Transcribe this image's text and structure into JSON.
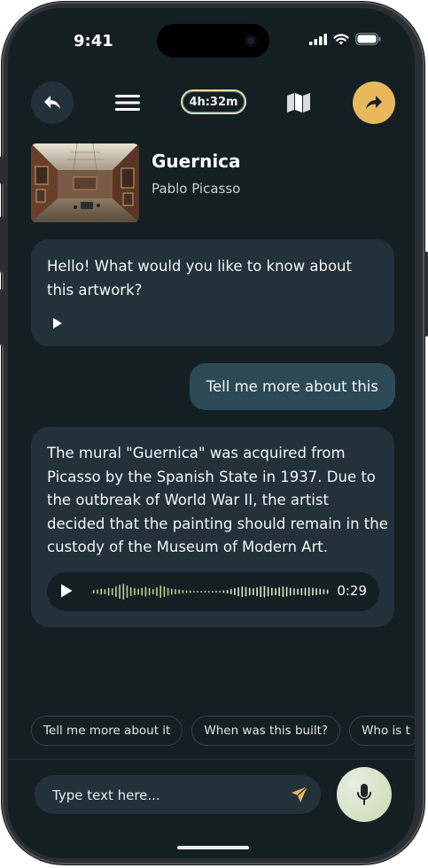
{
  "status_bar": {
    "time": "9:41"
  },
  "toolbar": {
    "timer": "4h:32m"
  },
  "artwork": {
    "title": "Guernica",
    "artist": "Pablo Picasso"
  },
  "chat": {
    "messages": [
      {
        "role": "assistant",
        "text": "Hello! What would you like to know about this artwork?"
      },
      {
        "role": "user",
        "text": "Tell me more about this"
      },
      {
        "role": "assistant",
        "text": "The mural \"Guernica\" was acquired from Picasso by the Spanish State in 1937. Due to the outbreak of World War II, the artist decided that the painting should remain in the custody of the Museum of Modern Art.",
        "audio_duration": "0:29"
      }
    ]
  },
  "suggestions": [
    "Tell me more about it",
    "When was this built?",
    "Who is t"
  ],
  "composer": {
    "placeholder": "Type text here..."
  },
  "colors": {
    "accent": "#e8b85a",
    "background": "#141f24",
    "bubble": "#22313a",
    "user_bubble": "#2b4a55"
  },
  "icons": [
    "back-arrow-icon",
    "hamburger-menu-icon",
    "map-icon",
    "share-arrow-icon",
    "play-icon",
    "send-icon",
    "microphone-icon",
    "signal-icon",
    "wifi-icon",
    "battery-icon"
  ]
}
